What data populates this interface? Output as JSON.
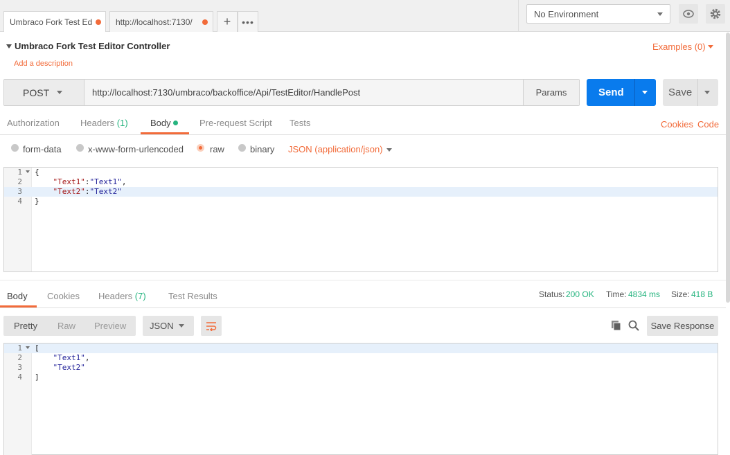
{
  "tabs": [
    {
      "label": "Umbraco Fork Test Ed"
    },
    {
      "label": "http://localhost:7130/"
    }
  ],
  "environment": {
    "selected": "No Environment"
  },
  "request": {
    "name": "Umbraco Fork Test Editor Controller",
    "description_link": "Add a description",
    "examples": "Examples (0)",
    "method": "POST",
    "url": "http://localhost:7130/umbraco/backoffice/Api/TestEditor/HandlePost",
    "params_label": "Params",
    "send_label": "Send",
    "save_label": "Save"
  },
  "request_tabs": {
    "authorization": "Authorization",
    "headers": "Headers",
    "headers_count": "(1)",
    "body": "Body",
    "prerequest": "Pre-request Script",
    "tests": "Tests",
    "cookies": "Cookies",
    "code": "Code"
  },
  "body_modes": {
    "form_data": "form-data",
    "urlencoded": "x-www-form-urlencoded",
    "raw": "raw",
    "binary": "binary",
    "content_type": "JSON (application/json)"
  },
  "request_body_lines": [
    {
      "n": "1",
      "text": "{"
    },
    {
      "n": "2",
      "key": "\"Text1\"",
      "sep": ":",
      "val": "\"Text1\"",
      "end": ","
    },
    {
      "n": "3",
      "key": "\"Text2\"",
      "sep": ":",
      "val": "\"Text2\"",
      "end": ""
    },
    {
      "n": "4",
      "text": "}"
    }
  ],
  "response_tabs": {
    "body": "Body",
    "cookies": "Cookies",
    "headers": "Headers",
    "headers_count": "(7)",
    "test_results": "Test Results"
  },
  "response_status": {
    "status_label": "Status:",
    "status_value": "200 OK",
    "time_label": "Time:",
    "time_value": "4834 ms",
    "size_label": "Size:",
    "size_value": "418 B"
  },
  "response_toolbar": {
    "pretty": "Pretty",
    "raw": "Raw",
    "preview": "Preview",
    "format": "JSON",
    "save_response": "Save Response"
  },
  "response_body_lines": [
    {
      "n": "1",
      "text": "["
    },
    {
      "n": "2",
      "val": "\"Text1\"",
      "end": ","
    },
    {
      "n": "3",
      "val": "\"Text2\"",
      "end": ""
    },
    {
      "n": "4",
      "text": "]"
    }
  ],
  "colors": {
    "accent": "#f26b3a",
    "send": "#097bed",
    "success": "#26b47f"
  },
  "icons": [
    "plus-icon",
    "more-icon",
    "eye-icon",
    "gear-icon",
    "wrap-icon",
    "copy-icon",
    "search-icon"
  ]
}
